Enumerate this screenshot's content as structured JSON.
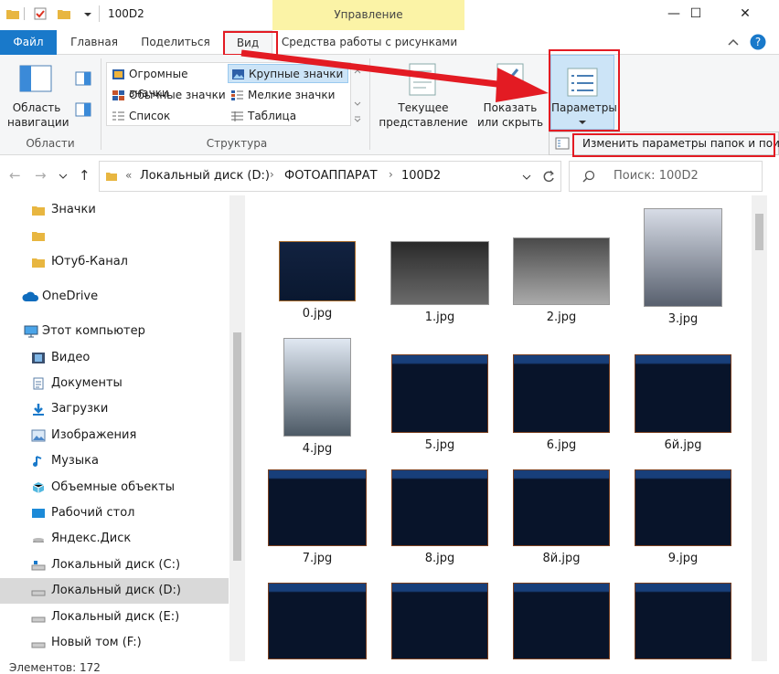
{
  "window": {
    "title": "100D2",
    "manage_tab": "Управление",
    "minimize": "—",
    "maximize": "☐",
    "close": "✕"
  },
  "ribbon_tabs": {
    "file": "Файл",
    "home": "Главная",
    "share": "Поделиться",
    "view": "Вид",
    "picture_tools": "Средства работы с рисунками"
  },
  "ribbon": {
    "nav_pane_label": "Область навигации",
    "panes_group": "Области",
    "layout_group": "Структура",
    "layout_items": [
      "Огромные значки",
      "Обычные значки",
      "Список",
      "Крупные значки",
      "Мелкие значки",
      "Таблица"
    ],
    "current_view": "Текущее представление",
    "show_hide": "Показать или скрыть",
    "options": "Параметры",
    "change_options": "Изменить параметры папок и поиска"
  },
  "address": {
    "path": [
      "Локальный диск (D:)",
      "ФОТОАППАРАТ",
      "100D2"
    ],
    "search_placeholder": "Поиск: 100D2"
  },
  "nav_items": [
    {
      "label": "Значки",
      "icon": "folder-icon"
    },
    {
      "label": "",
      "icon": "folder-icon"
    },
    {
      "label": "Ютуб-Канал",
      "icon": "folder-icon"
    },
    {
      "label": "OneDrive",
      "icon": "cloud-icon"
    },
    {
      "label": "Этот компьютер",
      "icon": "computer-icon"
    },
    {
      "label": "Видео",
      "icon": "video-icon"
    },
    {
      "label": "Документы",
      "icon": "documents-icon"
    },
    {
      "label": "Загрузки",
      "icon": "download-icon"
    },
    {
      "label": "Изображения",
      "icon": "pictures-icon"
    },
    {
      "label": "Музыка",
      "icon": "music-icon"
    },
    {
      "label": "Объемные объекты",
      "icon": "3d-objects-icon"
    },
    {
      "label": "Рабочий стол",
      "icon": "desktop-icon"
    },
    {
      "label": "Яндекс.Диск",
      "icon": "yandex-disk-icon"
    },
    {
      "label": "Локальный диск (C:)",
      "icon": "drive-icon"
    },
    {
      "label": "Локальный диск (D:)",
      "icon": "drive-icon"
    },
    {
      "label": "Локальный диск (E:)",
      "icon": "drive-icon"
    },
    {
      "label": "Новый том (F:)",
      "icon": "drive-icon"
    }
  ],
  "files": [
    "0.jpg",
    "1.jpg",
    "2.jpg",
    "3.jpg",
    "4.jpg",
    "5.jpg",
    "6.jpg",
    "6й.jpg",
    "7.jpg",
    "8.jpg",
    "8й.jpg",
    "9.jpg",
    "",
    "",
    "",
    ""
  ],
  "status": {
    "count_text": "Элементов: 172"
  },
  "colors": {
    "accent": "#1979ca",
    "manage_tab": "#fbf3a6",
    "annotation": "#e31b23",
    "selection": "#cce4f7"
  }
}
